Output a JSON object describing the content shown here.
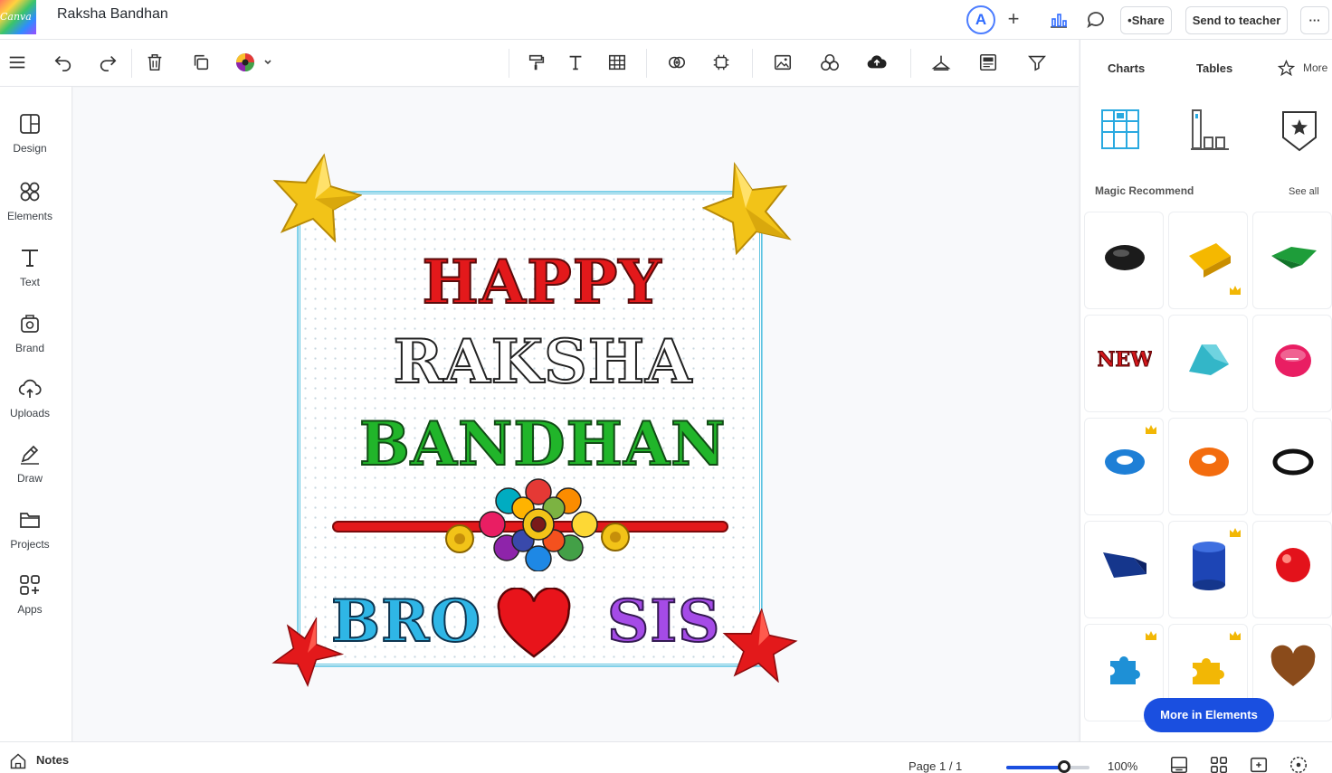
{
  "app": {
    "logo_text": "Canva",
    "document_title": "Raksha Bandhan"
  },
  "header": {
    "avatar_initial": "A",
    "add_label": "+",
    "share_label": "•Share",
    "send_label": "Send to teacher",
    "more_label": "···"
  },
  "toolbar": {
    "tools": [
      {
        "name": "menu-icon",
        "group": "edit"
      },
      {
        "name": "undo-icon",
        "group": "edit"
      },
      {
        "name": "redo-icon",
        "group": "edit"
      },
      {
        "name": "delete-icon",
        "group": "edit"
      },
      {
        "name": "duplicate-icon",
        "group": "edit"
      },
      {
        "name": "color-icon",
        "group": "edit"
      },
      {
        "name": "format-paint-icon",
        "group": "insert"
      },
      {
        "name": "text-icon",
        "group": "insert"
      },
      {
        "name": "table-icon",
        "group": "insert"
      },
      {
        "name": "link-icon",
        "group": "arrange"
      },
      {
        "name": "group-icon",
        "group": "arrange"
      },
      {
        "name": "image-icon",
        "group": "media"
      },
      {
        "name": "shapes-icon",
        "group": "media"
      },
      {
        "name": "cloud-upload-icon",
        "group": "media"
      },
      {
        "name": "hanger-icon",
        "group": "view"
      },
      {
        "name": "frame-icon",
        "group": "view"
      },
      {
        "name": "filter-icon",
        "group": "view"
      }
    ]
  },
  "rail": {
    "items": [
      {
        "label": "Design",
        "icon": "design-icon"
      },
      {
        "label": "Elements",
        "icon": "elements-icon"
      },
      {
        "label": "Text",
        "icon": "text-icon"
      },
      {
        "label": "Brand",
        "icon": "brand-icon"
      },
      {
        "label": "Uploads",
        "icon": "uploads-icon"
      },
      {
        "label": "Draw",
        "icon": "draw-icon"
      },
      {
        "label": "Projects",
        "icon": "folder-icon"
      },
      {
        "label": "Apps",
        "icon": "apps-icon"
      }
    ]
  },
  "canvas": {
    "line1": "HAPPY",
    "line2": "RAKSHA",
    "line3": "BANDHAN",
    "bottom_left": "BRO",
    "bottom_right": "SIS",
    "colors": {
      "happy": "#e3191b",
      "bandhan": "#21b52a",
      "bro": "#2fb6e6",
      "sis": "#a54be7",
      "heart": "#e8141b",
      "star_gold": "#f2c318",
      "star_red": "#e3191b",
      "border": "#5fc2df"
    }
  },
  "panel": {
    "tabs": [
      "Charts",
      "Tables",
      "More"
    ],
    "section_title": "Magic Recommend",
    "see_all": "See all",
    "more_button": "More in Elements",
    "items": [
      {
        "icon": "black-blob-icon",
        "premium": false
      },
      {
        "icon": "yellow-wedge-icon",
        "premium": true
      },
      {
        "icon": "green-gem-icon",
        "premium": false
      },
      {
        "icon": "new-text-icon",
        "premium": false
      },
      {
        "icon": "teal-dome-icon",
        "premium": false
      },
      {
        "icon": "pink-button-icon",
        "premium": false
      },
      {
        "icon": "blue-ring-icon",
        "premium": true
      },
      {
        "icon": "orange-ring-icon",
        "premium": false
      },
      {
        "icon": "black-ring-icon",
        "premium": false
      },
      {
        "icon": "navy-prism-icon",
        "premium": false
      },
      {
        "icon": "blue-cylinder-icon",
        "premium": true
      },
      {
        "icon": "red-sphere-icon",
        "premium": false
      },
      {
        "icon": "blue-puzzle-icon",
        "premium": true
      },
      {
        "icon": "yellow-puzzle-icon",
        "premium": true
      },
      {
        "icon": "brown-heart-icon",
        "premium": false
      }
    ]
  },
  "footer": {
    "notes_label": "Notes",
    "page_label": "Page 1 / 1",
    "zoom_label": "100%",
    "zoom_fraction": 0.7
  }
}
